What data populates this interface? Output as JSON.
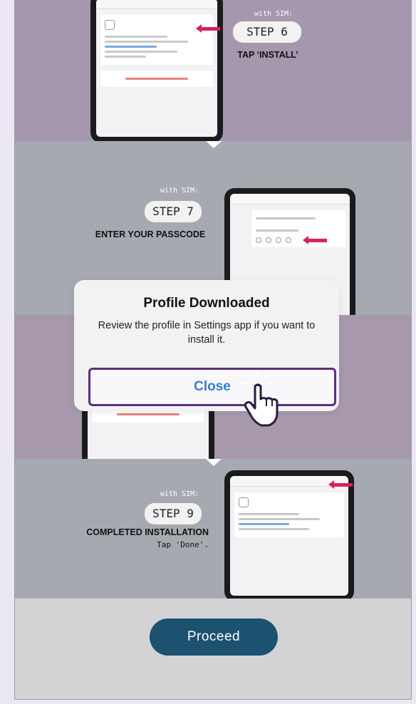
{
  "steps": {
    "step6": {
      "with_sim": "with SIM:",
      "label": "STEP 6",
      "caption": "TAP ‘INSTALL’"
    },
    "step7": {
      "with_sim": "with SIM:",
      "label": "STEP 7",
      "caption": "ENTER YOUR PASSCODE"
    },
    "step9": {
      "with_sim": "with SIM:",
      "label": "STEP 9",
      "caption": "COMPLETED INSTALLATION",
      "sub": "Tap 'Done'."
    }
  },
  "dialog": {
    "title": "Profile Downloaded",
    "message": "Review the profile in Settings app if you want to install it.",
    "close_label": "Close"
  },
  "footer": {
    "proceed_label": "Proceed"
  },
  "colors": {
    "accent": "#1c5170",
    "highlight": "#5a2f7c",
    "arrow": "#d6225f",
    "link": "#3b7bd0"
  }
}
